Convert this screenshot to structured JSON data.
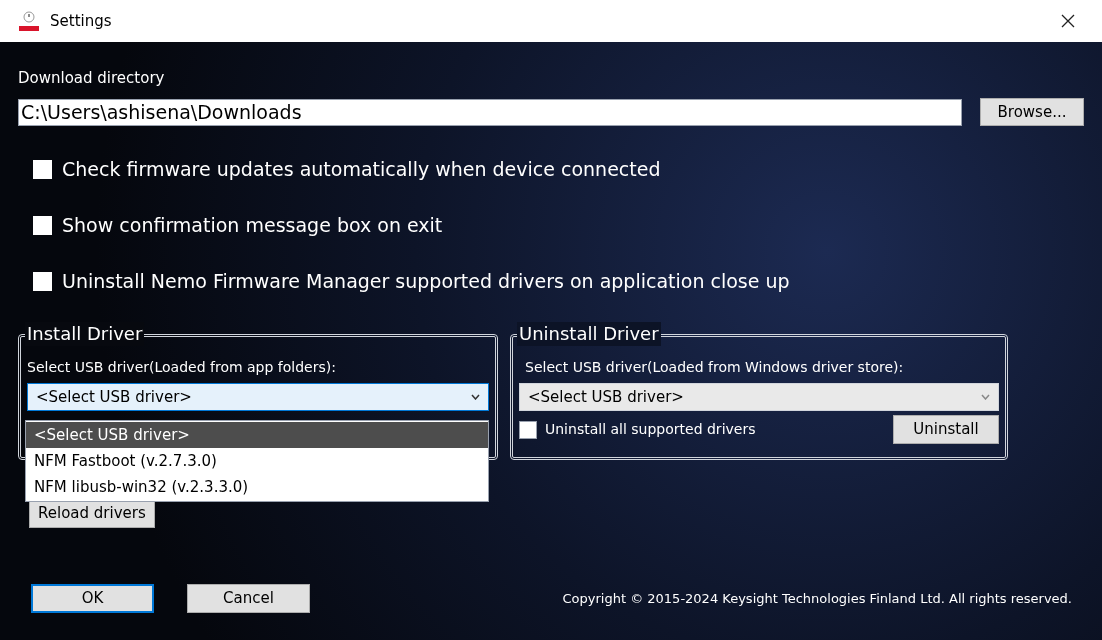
{
  "window": {
    "title": "Settings"
  },
  "download_directory": {
    "label": "Download directory",
    "value": "C:\\Users\\ashisena\\Downloads",
    "browse_button": "Browse..."
  },
  "options": [
    {
      "label": "Check firmware updates automatically when device connected",
      "checked": false
    },
    {
      "label": "Show confirmation message box on exit",
      "checked": false
    },
    {
      "label": "Uninstall Nemo Firmware Manager supported drivers on application close up",
      "checked": false
    }
  ],
  "install_driver": {
    "title": "Install Driver",
    "select_label": "Select USB driver(Loaded from app folders):",
    "select_value": "<Select USB driver>",
    "expanded": true,
    "dropdown_options": [
      {
        "label": "<Select USB driver>",
        "selected": true
      },
      {
        "label": "NFM Fastboot (v.2.7.3.0)",
        "selected": false
      },
      {
        "label": "NFM libusb-win32 (v.2.3.3.0)",
        "selected": false
      }
    ],
    "reload_button": "Reload drivers"
  },
  "uninstall_driver": {
    "title": "Uninstall Driver",
    "select_label": "Select USB driver(Loaded from Windows driver store):",
    "select_value": "<Select USB driver>",
    "uninstall_all": {
      "label": "Uninstall all supported drivers",
      "checked": false
    },
    "uninstall_button": "Uninstall"
  },
  "buttons": [
    {
      "label": "OK",
      "default": true
    },
    {
      "label": "Cancel",
      "default": false
    }
  ],
  "copyright": "Copyright © 2015-2024 Keysight Technologies Finland Ltd. All rights reserved."
}
